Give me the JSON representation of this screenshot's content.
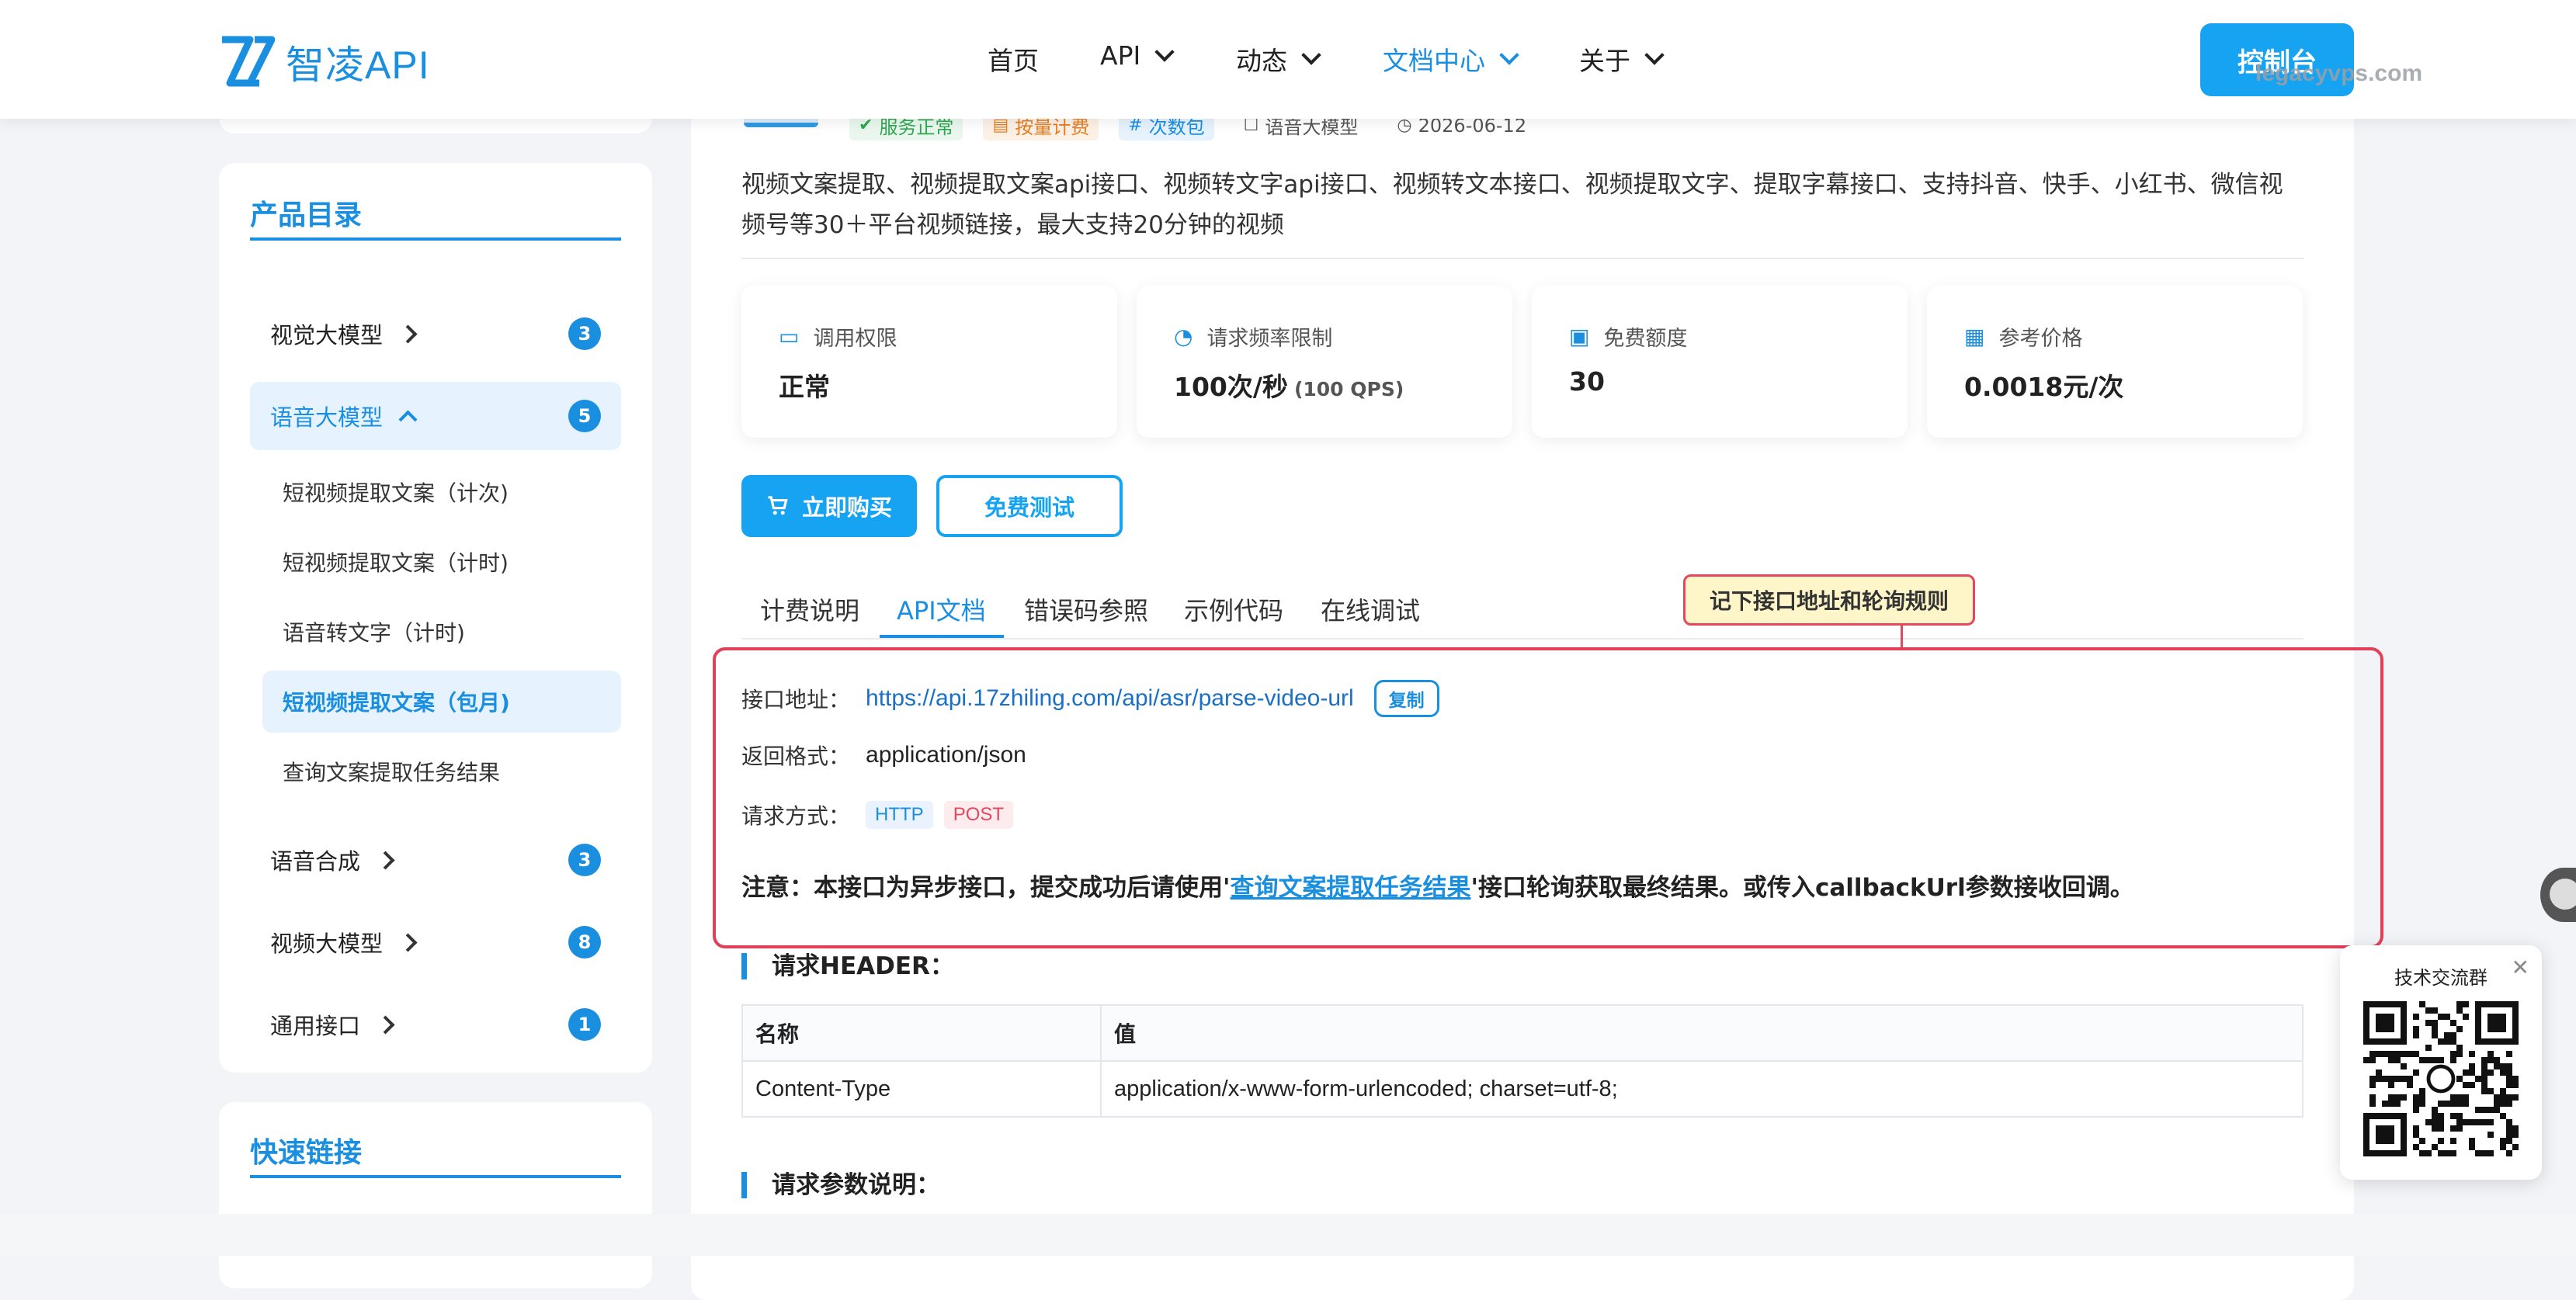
{
  "nav": {
    "logo_text": "智凌API",
    "items": [
      {
        "label": "首页",
        "dropdown": false
      },
      {
        "label": "API",
        "dropdown": true
      },
      {
        "label": "动态",
        "dropdown": true
      },
      {
        "label": "文档中心",
        "dropdown": true,
        "active": true
      },
      {
        "label": "关于",
        "dropdown": true
      }
    ],
    "console_label": "控制台",
    "watermark": "legacyvps.com"
  },
  "sidebar": {
    "catalog_title": "产品目录",
    "categories": [
      {
        "label": "视觉大模型",
        "count": "3"
      },
      {
        "label": "语音大模型",
        "count": "5",
        "expanded": true
      },
      {
        "label": "语音合成",
        "count": "3"
      },
      {
        "label": "视频大模型",
        "count": "8"
      },
      {
        "label": "通用接口",
        "count": "1"
      }
    ],
    "sub_items": [
      {
        "label": "短视频提取文案（计次)"
      },
      {
        "label": "短视频提取文案（计时)"
      },
      {
        "label": "语音转文字（计时)"
      },
      {
        "label": "短视频提取文案（包月)",
        "active": true
      },
      {
        "label": "查询文案提取任务结果"
      }
    ],
    "quick_links_title": "快速链接"
  },
  "product": {
    "tags": [
      {
        "label": "服务正常",
        "icon": "check-circle-icon",
        "style": "green"
      },
      {
        "label": "按量计费",
        "icon": "receipt-icon",
        "style": "orange"
      },
      {
        "label": "次数包",
        "icon": "hash-icon",
        "style": "blue"
      },
      {
        "label": "语音大模型",
        "icon": "tag-icon",
        "style": "plain"
      },
      {
        "label": "2026-06-12",
        "icon": "clock-icon",
        "style": "plain"
      }
    ],
    "description": "视频文案提取、视频提取文案api接口、视频转文字api接口、视频转文本接口、视频提取文字、提取字幕接口、支持抖音、快手、小红书、微信视频号等30＋平台视频链接，最大支持20分钟的视频",
    "stats": [
      {
        "label": "调用权限",
        "value": "正常",
        "sub": "",
        "icon": "id-card-icon"
      },
      {
        "label": "请求频率限制",
        "value": "100次/秒",
        "sub": "(100 QPS)",
        "icon": "speedometer-icon"
      },
      {
        "label": "免费额度",
        "value": "30",
        "sub": "",
        "icon": "gift-icon"
      },
      {
        "label": "参考价格",
        "value": "0.0018元/次",
        "sub": "",
        "icon": "calculator-icon"
      }
    ],
    "buy_label": "立即购买",
    "test_label": "免费测试"
  },
  "tabs": [
    {
      "label": "计费说明"
    },
    {
      "label": "API文档",
      "active": true
    },
    {
      "label": "错误码参照"
    },
    {
      "label": "示例代码"
    },
    {
      "label": "在线调试"
    }
  ],
  "callout": "记下接口地址和轮询规则",
  "api": {
    "url_label": "接口地址：",
    "url": "https://api.17zhiling.com/api/asr/parse-video-url",
    "copy_label": "复制",
    "format_label": "返回格式：",
    "format": "application/json",
    "method_label": "请求方式：",
    "methods": [
      "HTTP",
      "POST"
    ],
    "note_prefix": "注意：本接口为异步接口，提交成功后请使用'",
    "note_link": "查询文案提取任务结果",
    "note_suffix": "'接口轮询获取最终结果。或传入callbackUrl参数接收回调。"
  },
  "header_section": {
    "title": "请求HEADER：",
    "columns": [
      "名称",
      "值"
    ],
    "rows": [
      [
        "Content-Type",
        "application/x-www-form-urlencoded; charset=utf-8;"
      ]
    ]
  },
  "params_section_title": "请求参数说明：",
  "qr": {
    "title": "技术交流群"
  }
}
